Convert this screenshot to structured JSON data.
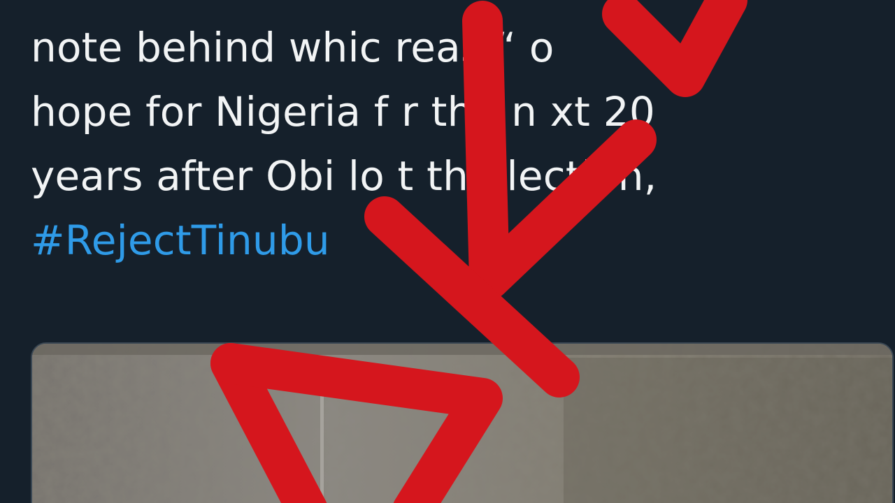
{
  "tweet": {
    "lines": [
      "note behind whic  reas  “ o",
      "hope for Nigeria f  r the n xt 20",
      "years after Obi lo t th  election,"
    ],
    "hashtag": "#RejectTinubu"
  },
  "media": {
    "description_icon": "photo"
  },
  "stamp": {
    "colors": {
      "stamp": "#d5161d"
    }
  }
}
